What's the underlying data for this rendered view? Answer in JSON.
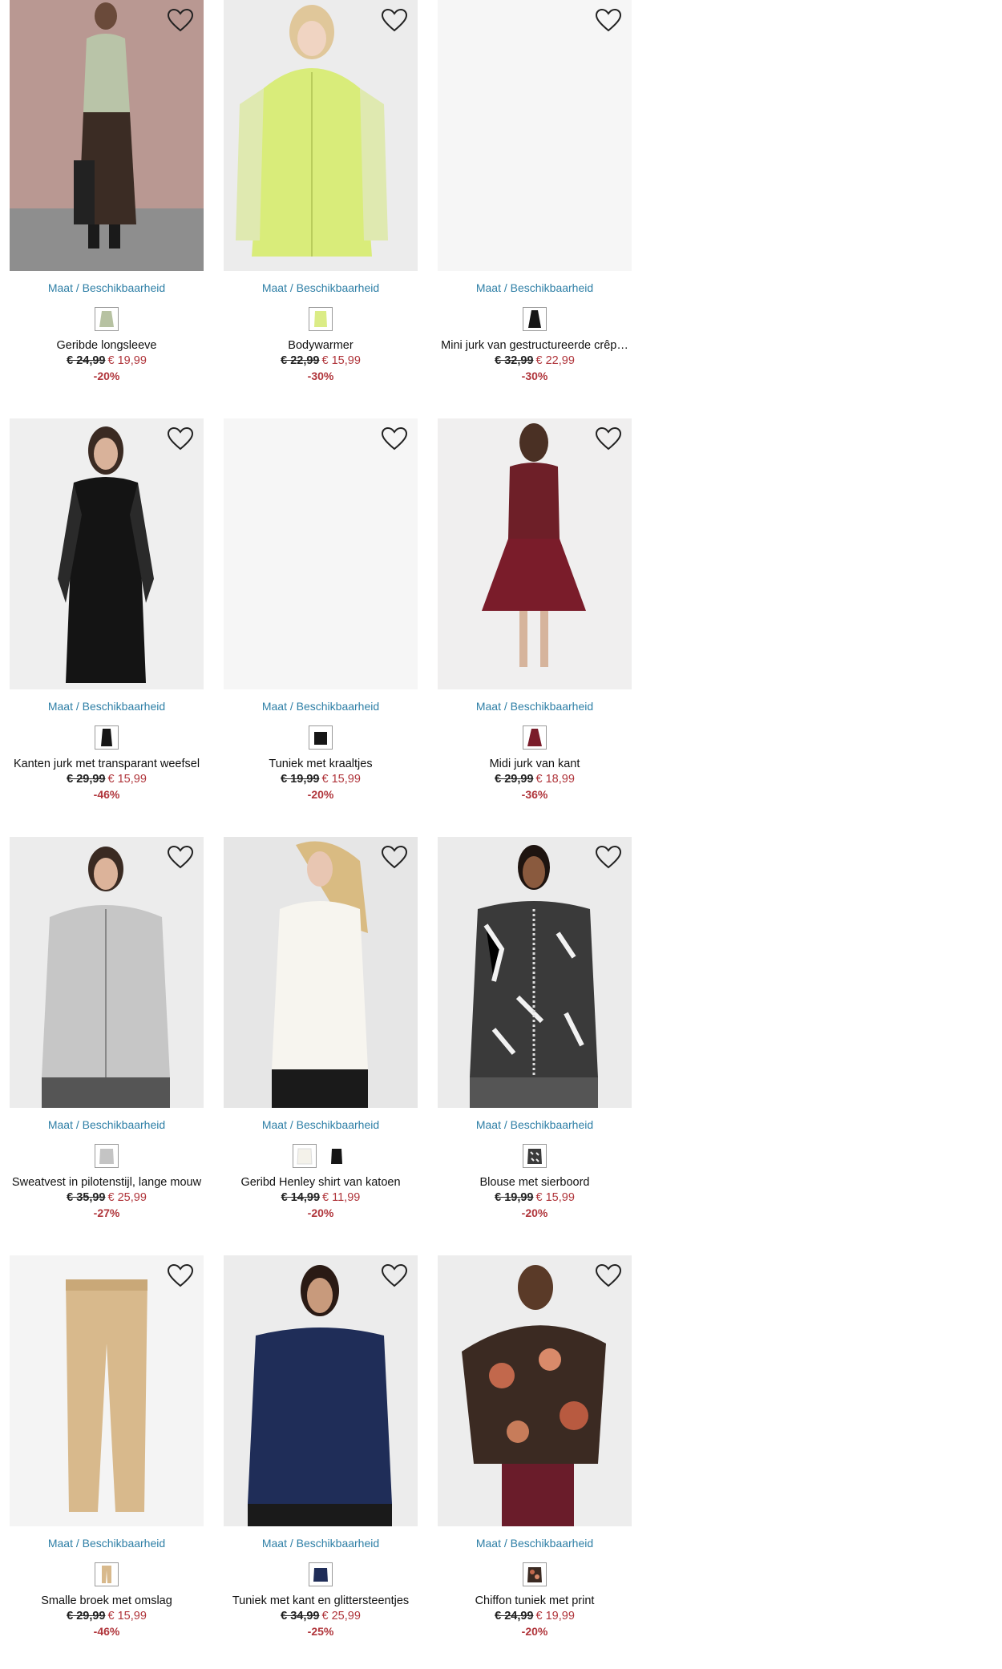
{
  "size_link_label": "Maat / Beschikbaarheid",
  "colors": {
    "link": "#2e7fa6",
    "sale": "#b0353b"
  },
  "products": [
    {
      "title": "Geribde longsleeve",
      "old_price": "€ 24,99",
      "new_price": "€ 19,99",
      "discount": "-20%",
      "swatches": [
        "sage"
      ]
    },
    {
      "title": "Bodywarmer",
      "old_price": "€ 22,99",
      "new_price": "€ 15,99",
      "discount": "-30%",
      "swatches": [
        "lime"
      ]
    },
    {
      "title": "Mini jurk van gestructureerde crêp…",
      "old_price": "€ 32,99",
      "new_price": "€ 22,99",
      "discount": "-30%",
      "swatches": [
        "black"
      ]
    },
    {
      "title": "Kanten jurk met transparant weefsel",
      "old_price": "€ 29,99",
      "new_price": "€ 15,99",
      "discount": "-46%",
      "swatches": [
        "black"
      ]
    },
    {
      "title": "Tuniek met kraaltjes",
      "old_price": "€ 19,99",
      "new_price": "€ 15,99",
      "discount": "-20%",
      "swatches": [
        "black"
      ]
    },
    {
      "title": "Midi jurk van kant",
      "old_price": "€ 29,99",
      "new_price": "€ 18,99",
      "discount": "-36%",
      "swatches": [
        "burgundy"
      ]
    },
    {
      "title": "Sweatvest in pilotenstijl, lange mouw",
      "old_price": "€ 35,99",
      "new_price": "€ 25,99",
      "discount": "-27%",
      "swatches": [
        "grey"
      ]
    },
    {
      "title": "Geribd Henley shirt van katoen",
      "old_price": "€ 14,99",
      "new_price": "€ 11,99",
      "discount": "-20%",
      "swatches": [
        "white",
        "black"
      ]
    },
    {
      "title": "Blouse met sierboord",
      "old_price": "€ 19,99",
      "new_price": "€ 15,99",
      "discount": "-20%",
      "swatches": [
        "print"
      ]
    },
    {
      "title": "Smalle broek met omslag",
      "old_price": "€ 29,99",
      "new_price": "€ 15,99",
      "discount": "-46%",
      "swatches": [
        "beige"
      ]
    },
    {
      "title": "Tuniek met kant en glittersteentjes",
      "old_price": "€ 34,99",
      "new_price": "€ 25,99",
      "discount": "-25%",
      "swatches": [
        "navy"
      ]
    },
    {
      "title": "Chiffon tuniek met print",
      "old_price": "€ 24,99",
      "new_price": "€ 19,99",
      "discount": "-20%",
      "swatches": [
        "floral"
      ]
    }
  ]
}
